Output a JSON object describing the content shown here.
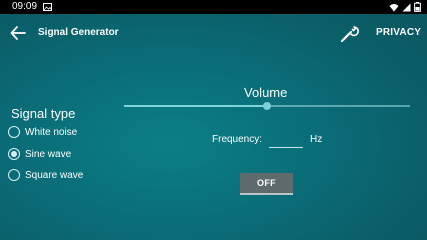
{
  "status_bar": {
    "time": "09:09",
    "icons": [
      "image-icon",
      "wifi-icon",
      "signal-icon",
      "battery-icon"
    ],
    "battery_text": "⚡"
  },
  "app_bar": {
    "title": "Signal Generator",
    "privacy_label": "PRIVACY"
  },
  "volume": {
    "label": "Volume",
    "level": 0.5
  },
  "signal_type": {
    "label": "Signal type",
    "options": [
      {
        "label": "White noise",
        "checked": false
      },
      {
        "label": "Sine wave",
        "checked": true
      },
      {
        "label": "Square wave",
        "checked": false
      }
    ]
  },
  "frequency": {
    "label": "Frequency:",
    "value": "",
    "unit": "Hz"
  },
  "toggle_button": {
    "label": "OFF"
  },
  "colors": {
    "background": "#0a6b76",
    "slider_accent": "#7ad0d8",
    "button_bg": "#5e6a6c"
  }
}
